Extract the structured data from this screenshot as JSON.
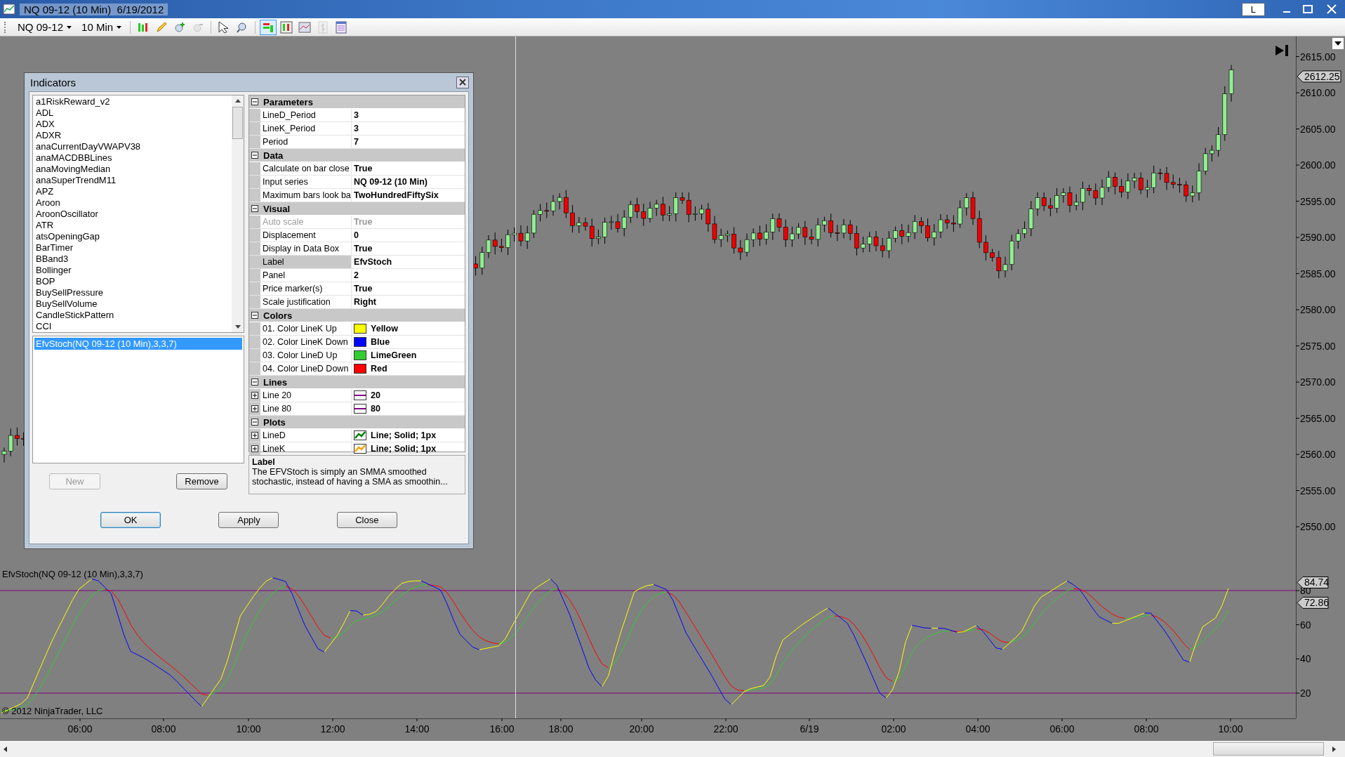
{
  "window": {
    "title": "NQ 09-12 (10 Min)  6/19/2012",
    "tab": "L"
  },
  "toolbar": {
    "instrument": "NQ 09-12",
    "interval": "10 Min",
    "tools": [
      {
        "kind": "bars",
        "selected": false,
        "disabled": false
      },
      {
        "kind": "pencil",
        "selected": false,
        "disabled": false
      },
      {
        "kind": "zoom-in",
        "selected": false,
        "disabled": false
      },
      {
        "kind": "zoom-out",
        "selected": false,
        "disabled": true
      },
      {
        "kind": "cursor",
        "selected": false,
        "disabled": false
      },
      {
        "kind": "search",
        "selected": false,
        "disabled": false
      },
      {
        "kind": "indicators",
        "selected": true,
        "disabled": false
      },
      {
        "kind": "strategies",
        "selected": false,
        "disabled": false
      },
      {
        "kind": "chart",
        "selected": false,
        "disabled": false
      },
      {
        "kind": "dollar",
        "selected": false,
        "disabled": true
      },
      {
        "kind": "table",
        "selected": false,
        "disabled": false
      }
    ]
  },
  "price_axis": {
    "ticks": [
      "2615.00",
      "2610.00",
      "2605.00",
      "2600.00",
      "2595.00",
      "2590.00",
      "2585.00",
      "2580.00",
      "2575.00",
      "2570.00",
      "2565.00",
      "2560.00",
      "2555.00",
      "2550.00"
    ],
    "last_price": "2612.25"
  },
  "indicator_panel": {
    "label": "EfvStoch(NQ 09-12 (10 Min),3,3,7)",
    "copyright": "© 2012 NinjaTrader, LLC",
    "ticks": [
      "80",
      "60",
      "40",
      "20"
    ],
    "markers": [
      "84.74",
      "72.86"
    ]
  },
  "time_axis": {
    "labels": [
      "06:00",
      "08:00",
      "10:00",
      "12:00",
      "14:00",
      "16:00",
      "18:00",
      "20:00",
      "22:00",
      "6/19",
      "02:00",
      "04:00",
      "06:00",
      "08:00",
      "10:00"
    ]
  },
  "dialog": {
    "title": "Indicators",
    "available": [
      "a1RiskReward_v2",
      "ADL",
      "ADX",
      "ADXR",
      "anaCurrentDayVWAPV38",
      "anaMACDBBLines",
      "anaMovingMedian",
      "anaSuperTrendM11",
      "APZ",
      "Aroon",
      "AroonOscillator",
      "ATR",
      "atsOpeningGap",
      "BarTimer",
      "BBand3",
      "Bollinger",
      "BOP",
      "BuySellPressure",
      "BuySellVolume",
      "CandleStickPattern",
      "CCI"
    ],
    "applied": [
      {
        "label": "EfvStoch(NQ 09-12 (10 Min),3,3,7)",
        "selected": true
      }
    ],
    "list_buttons": [
      {
        "label": "New",
        "disabled": true
      },
      {
        "label": "Remove",
        "disabled": false
      }
    ],
    "properties": [
      {
        "category": "Parameters",
        "expanded": true,
        "rows": [
          {
            "kind": "text",
            "name": "LineD_Period",
            "value": "3",
            "disabled": false,
            "selected": false,
            "expandable": false
          },
          {
            "kind": "text",
            "name": "LineK_Period",
            "value": "3",
            "disabled": false,
            "selected": false,
            "expandable": false
          },
          {
            "kind": "text",
            "name": "Period",
            "value": "7",
            "disabled": false,
            "selected": false,
            "expandable": false
          }
        ]
      },
      {
        "category": "Data",
        "expanded": true,
        "rows": [
          {
            "kind": "text",
            "name": "Calculate on bar close",
            "value": "True",
            "disabled": false,
            "selected": false,
            "expandable": false
          },
          {
            "kind": "text",
            "name": "Input series",
            "value": "NQ 09-12 (10 Min)",
            "disabled": false,
            "selected": false,
            "expandable": false
          },
          {
            "kind": "text",
            "name": "Maximum bars look ba",
            "value": "TwoHundredFiftySix",
            "disabled": false,
            "selected": false,
            "expandable": false
          }
        ]
      },
      {
        "category": "Visual",
        "expanded": true,
        "rows": [
          {
            "kind": "text",
            "name": "Auto scale",
            "value": "True",
            "disabled": true,
            "selected": false,
            "expandable": false
          },
          {
            "kind": "text",
            "name": "Displacement",
            "value": "0",
            "disabled": false,
            "selected": false,
            "expandable": false
          },
          {
            "kind": "text",
            "name": "Display in Data Box",
            "value": "True",
            "disabled": false,
            "selected": false,
            "expandable": false
          },
          {
            "kind": "text",
            "name": "Label",
            "value": "EfvStoch",
            "disabled": false,
            "selected": true,
            "expandable": false
          },
          {
            "kind": "text",
            "name": "Panel",
            "value": "2",
            "disabled": false,
            "selected": false,
            "expandable": false
          },
          {
            "kind": "text",
            "name": "Price marker(s)",
            "value": "True",
            "disabled": false,
            "selected": false,
            "expandable": false
          },
          {
            "kind": "text",
            "name": "Scale justification",
            "value": "Right",
            "disabled": false,
            "selected": false,
            "expandable": false
          }
        ]
      },
      {
        "category": "Colors",
        "expanded": true,
        "rows": [
          {
            "kind": "color",
            "name": "01. Color LineK Up",
            "value": "Yellow",
            "color": "#ffff00",
            "disabled": false,
            "selected": false,
            "expandable": false
          },
          {
            "kind": "color",
            "name": "02. Color LineK Down",
            "value": "Blue",
            "color": "#0000ff",
            "disabled": false,
            "selected": false,
            "expandable": false
          },
          {
            "kind": "color",
            "name": "03. Color LineD Up",
            "value": "LimeGreen",
            "color": "#32cd32",
            "disabled": false,
            "selected": false,
            "expandable": false
          },
          {
            "kind": "color",
            "name": "04. Color LineD Down",
            "value": "Red",
            "color": "#ff0000",
            "disabled": false,
            "selected": false,
            "expandable": false
          }
        ]
      },
      {
        "category": "Lines",
        "expanded": true,
        "rows": [
          {
            "kind": "line",
            "name": "Line 20",
            "value": "20",
            "color": "#800080",
            "disabled": false,
            "selected": false,
            "expandable": true
          },
          {
            "kind": "line",
            "name": "Line 80",
            "value": "80",
            "color": "#800080",
            "disabled": false,
            "selected": false,
            "expandable": true
          }
        ]
      },
      {
        "category": "Plots",
        "expanded": true,
        "rows": [
          {
            "kind": "plot",
            "name": "LineD",
            "value": "Line; Solid; 1px",
            "color": "#008000",
            "disabled": false,
            "selected": false,
            "expandable": true
          },
          {
            "kind": "plot",
            "name": "LineK",
            "value": "Line; Solid; 1px",
            "color": "#ffa500",
            "disabled": false,
            "selected": false,
            "expandable": true
          }
        ]
      }
    ],
    "description": {
      "title": "Label",
      "text": "The EFVStoch is simply an SMMA smoothed stochastic, instead of having a SMA as smoothin..."
    },
    "footer_buttons": [
      {
        "label": "OK",
        "default": true
      },
      {
        "label": "Apply",
        "default": false
      },
      {
        "label": "Close",
        "default": false
      }
    ]
  }
}
